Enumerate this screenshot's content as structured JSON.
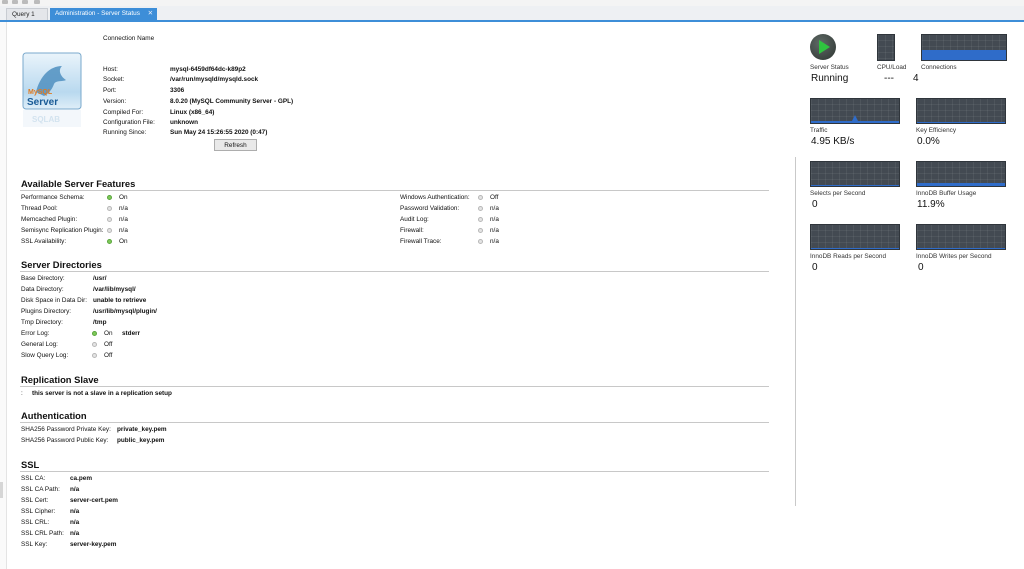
{
  "tabs": [
    {
      "label": "Query 1",
      "active": false
    },
    {
      "label": "Administration - Server Status",
      "active": true
    }
  ],
  "logo": {
    "text1": "MySQL",
    "text2": "Server",
    "text3": "SQLAB"
  },
  "connection": {
    "title": "Connection Name",
    "fields": [
      {
        "key": "Host:",
        "value": "mysql-6459df64dc-k89p2"
      },
      {
        "key": "Socket:",
        "value": "/var/run/mysqld/mysqld.sock"
      },
      {
        "key": "Port:",
        "value": "3306"
      },
      {
        "key": "Version:",
        "value": "8.0.20 (MySQL Community Server - GPL)"
      },
      {
        "key": "Compiled For:",
        "value": "Linux   (x86_64)"
      },
      {
        "key": "Configuration File:",
        "value": "unknown"
      },
      {
        "key": "Running Since:",
        "value": "Sun May 24 15:26:55 2020 (0:47)"
      }
    ],
    "refresh_label": "Refresh"
  },
  "features": {
    "title": "Available Server Features",
    "left": [
      {
        "label": "Performance Schema:",
        "state": "on",
        "value": "On"
      },
      {
        "label": "Thread Pool:",
        "state": "off",
        "value": "n/a"
      },
      {
        "label": "Memcached Plugin:",
        "state": "off",
        "value": "n/a"
      },
      {
        "label": "Semisync Replication Plugin:",
        "state": "off",
        "value": "n/a"
      },
      {
        "label": "SSL Availability:",
        "state": "on",
        "value": "On"
      }
    ],
    "right": [
      {
        "label": "Windows Authentication:",
        "state": "off",
        "value": "Off"
      },
      {
        "label": "Password Validation:",
        "state": "off",
        "value": "n/a"
      },
      {
        "label": "Audit Log:",
        "state": "off",
        "value": "n/a"
      },
      {
        "label": "Firewall:",
        "state": "off",
        "value": "n/a"
      },
      {
        "label": "Firewall Trace:",
        "state": "off",
        "value": "n/a"
      }
    ]
  },
  "directories": {
    "title": "Server Directories",
    "items": [
      {
        "label": "Base Directory:",
        "value": "/usr/"
      },
      {
        "label": "Data Directory:",
        "value": "/var/lib/mysql/"
      },
      {
        "label": "Disk Space in Data Dir:",
        "value": "unable to retrieve"
      },
      {
        "label": "Plugins Directory:",
        "value": "/usr/lib/mysql/plugin/"
      },
      {
        "label": "Tmp Directory:",
        "value": "/tmp"
      }
    ],
    "logs": [
      {
        "label": "Error Log:",
        "state": "on",
        "value": "On",
        "extra": "stderr"
      },
      {
        "label": "General Log:",
        "state": "off",
        "value": "Off",
        "extra": ""
      },
      {
        "label": "Slow Query Log:",
        "state": "off",
        "value": "Off",
        "extra": ""
      }
    ]
  },
  "replication": {
    "title": "Replication Slave",
    "prefix": ":",
    "text": "this server is not a slave in a replication setup"
  },
  "authentication": {
    "title": "Authentication",
    "items": [
      {
        "label": "SHA256 Password Private Key:",
        "value": "private_key.pem"
      },
      {
        "label": "SHA256 Password Public Key:",
        "value": "public_key.pem"
      }
    ]
  },
  "ssl": {
    "title": "SSL",
    "items": [
      {
        "label": "SSL CA:",
        "value": "ca.pem"
      },
      {
        "label": "SSL CA Path:",
        "value": "n/a"
      },
      {
        "label": "SSL Cert:",
        "value": "server-cert.pem"
      },
      {
        "label": "SSL Cipher:",
        "value": "n/a"
      },
      {
        "label": "SSL CRL:",
        "value": "n/a"
      },
      {
        "label": "SSL CRL Path:",
        "value": "n/a"
      },
      {
        "label": "SSL Key:",
        "value": "server-key.pem"
      }
    ]
  },
  "status": {
    "server_status": {
      "label": "Server Status",
      "value": "Running"
    },
    "cpu_load": {
      "label": "CPU/Load",
      "value": "---"
    },
    "connections": {
      "label": "Connections",
      "value": "4"
    },
    "traffic": {
      "label": "Traffic",
      "value": "4.95 KB/s"
    },
    "key_efficiency": {
      "label": "Key Efficiency",
      "value": "0.0%"
    },
    "selects": {
      "label": "Selects per Second",
      "value": "0"
    },
    "innodb_buffer": {
      "label": "InnoDB Buffer Usage",
      "value": "11.9%"
    },
    "innodb_reads": {
      "label": "InnoDB Reads per Second",
      "value": "0"
    },
    "innodb_writes": {
      "label": "InnoDB Writes per Second",
      "value": "0"
    }
  },
  "colors": {
    "accent": "#3d8ed8",
    "graph_bg": "#434a52",
    "graph_line": "#2f6cc9",
    "on": "#7fca5a",
    "off": "#e4e4e4"
  }
}
